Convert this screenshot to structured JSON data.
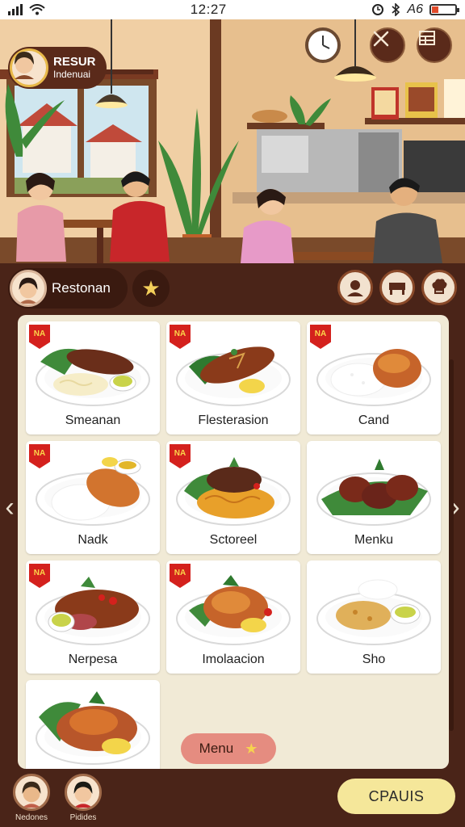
{
  "status_bar": {
    "time": "12:27",
    "network": "A6",
    "battery_level": 0.3,
    "icons": [
      "signal-icon",
      "wifi-icon",
      "alarm-icon",
      "bluetooth-icon",
      "battery-icon"
    ]
  },
  "header": {
    "profile_title": "RESUR",
    "profile_subtitle": "Indenuai",
    "buttons": [
      "cutlery-icon",
      "grid-icon"
    ]
  },
  "restaurant_bar": {
    "name": "Restonan",
    "buttons": [
      "star-icon",
      "chef-icon",
      "counter-icon",
      "chef-hat-icon"
    ]
  },
  "menu": {
    "badge_text": "NA",
    "items": [
      {
        "label": "Smeanan",
        "badge": true,
        "icon": "steak-noodles-icon"
      },
      {
        "label": "Flesterasion",
        "badge": true,
        "icon": "grilled-chicken-icon"
      },
      {
        "label": "Cand",
        "badge": true,
        "icon": "chicken-rice-icon"
      },
      {
        "label": "Nadk",
        "badge": true,
        "icon": "roast-rice-icon"
      },
      {
        "label": "Sctoreel",
        "badge": true,
        "icon": "steak-spaghetti-icon"
      },
      {
        "label": "Menku",
        "badge": false,
        "icon": "roast-drumsticks-icon"
      },
      {
        "label": "Nerpesa",
        "badge": true,
        "icon": "roast-meat-icon"
      },
      {
        "label": "Imolaacion",
        "badge": true,
        "icon": "roast-chicken-icon"
      },
      {
        "label": "Sho",
        "badge": false,
        "icon": "fried-fish-icon"
      },
      {
        "label": "",
        "badge": false,
        "icon": "roast-chicken-lemon-icon"
      }
    ],
    "menu_button_label": "Menu"
  },
  "bottom_bar": {
    "players": [
      {
        "name": "Nedones"
      },
      {
        "name": "Pidides"
      }
    ],
    "cta_label": "CPAUIS"
  },
  "colors": {
    "panel": "#f1ead6",
    "bar": "#4a2418",
    "badge": "#d4211d",
    "cta": "#f5e79a",
    "menu_button": "#e58c80"
  }
}
